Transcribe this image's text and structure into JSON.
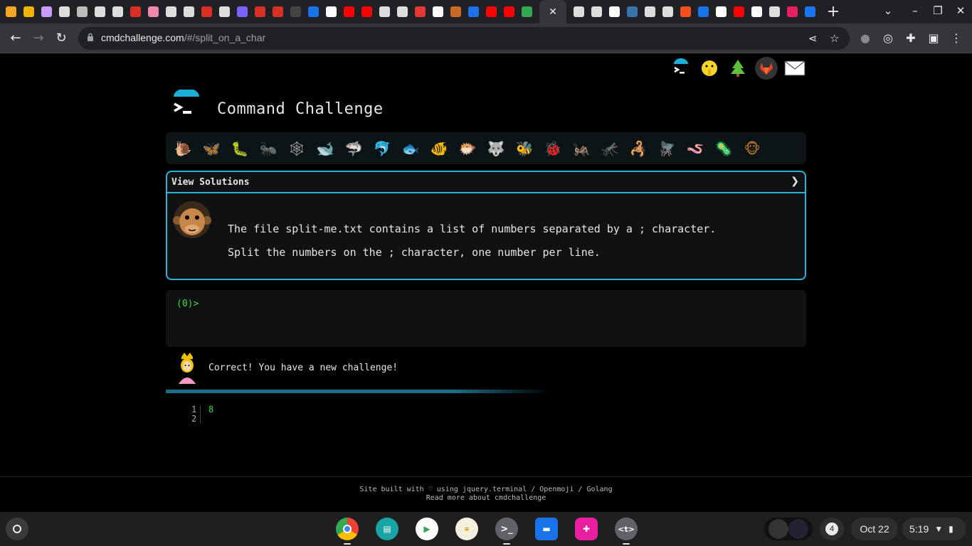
{
  "browser": {
    "url_host": "cmdchallenge.com",
    "url_path": "/#/split_on_a_char"
  },
  "site": {
    "title": "Command Challenge",
    "solutions_label": "View Solutions",
    "solutions_chevron": "❯",
    "description_lines": [
      "The file split-me.txt contains a list of numbers separated by a ; character.",
      "Split the numbers on the ; character, one number per line."
    ],
    "prompt": "(0)>",
    "result_message": "Correct! You have a new challenge!",
    "output": {
      "line_numbers": [
        "1",
        "2"
      ],
      "lines": [
        "8",
        ""
      ]
    },
    "footer_line1": "Site built with ♡ using jquery.terminal / Openmoji / Golang",
    "footer_line2": "Read more about cmdchallenge"
  },
  "shelf": {
    "notification_count": "4",
    "date": "Oct 22",
    "time": "5:19"
  }
}
